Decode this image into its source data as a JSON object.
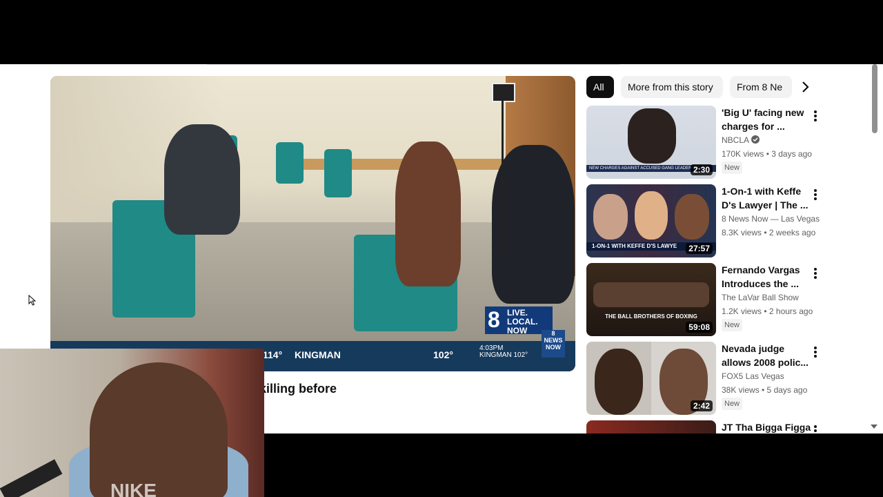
{
  "player": {
    "logo_lines": [
      "LIVE.",
      "LOCAL.",
      "NOW"
    ],
    "logo_number": "8",
    "ticker": {
      "temp1": "114°",
      "city": "KINGMAN",
      "temp2": "102°",
      "time": "4:03PM",
      "small_city": "KINGMAN 102°",
      "left_brand": "ornate"
    },
    "corner_logo": "8 NEWS NOW"
  },
  "video_title": "oney': Keffe D denies role in Tupac killing before",
  "chips": [
    "All",
    "More from this story",
    "From 8 Ne"
  ],
  "recommendations": [
    {
      "title": "'Big U' facing new charges for ...",
      "channel": "NBCLA",
      "verified": true,
      "stats": "170K views • 3 days ago",
      "badge": "New",
      "duration": "2:30",
      "thumb_text": "NEW CHARGES AGAINST ACCUSED GANG LEADER 'BIG U'"
    },
    {
      "title": "1-On-1 with Keffe D's Lawyer | The ...",
      "channel": "8 News Now — Las Vegas",
      "verified": false,
      "stats": "8.3K views • 2 weeks ago",
      "badge": "",
      "duration": "27:57",
      "thumb_text": "1-ON-1 WITH KEFFE D'S LAWYE"
    },
    {
      "title": "Fernando Vargas Introduces the ...",
      "channel": "The LaVar Ball Show",
      "verified": false,
      "stats": "1.2K views • 2 hours ago",
      "badge": "New",
      "duration": "59:08",
      "thumb_text": "THE BALL BROTHERS OF BOXING"
    },
    {
      "title": "Nevada judge allows 2008 polic...",
      "channel": "FOX5 Las Vegas",
      "verified": false,
      "stats": "38K views • 5 days ago",
      "badge": "New",
      "duration": "2:42",
      "thumb_text": ""
    },
    {
      "title": "JT Tha Bigga Figga",
      "channel": "",
      "verified": false,
      "stats": "",
      "badge": "",
      "duration": "",
      "thumb_text": ""
    }
  ],
  "webcam": {
    "shirt_text": "NIKE"
  }
}
